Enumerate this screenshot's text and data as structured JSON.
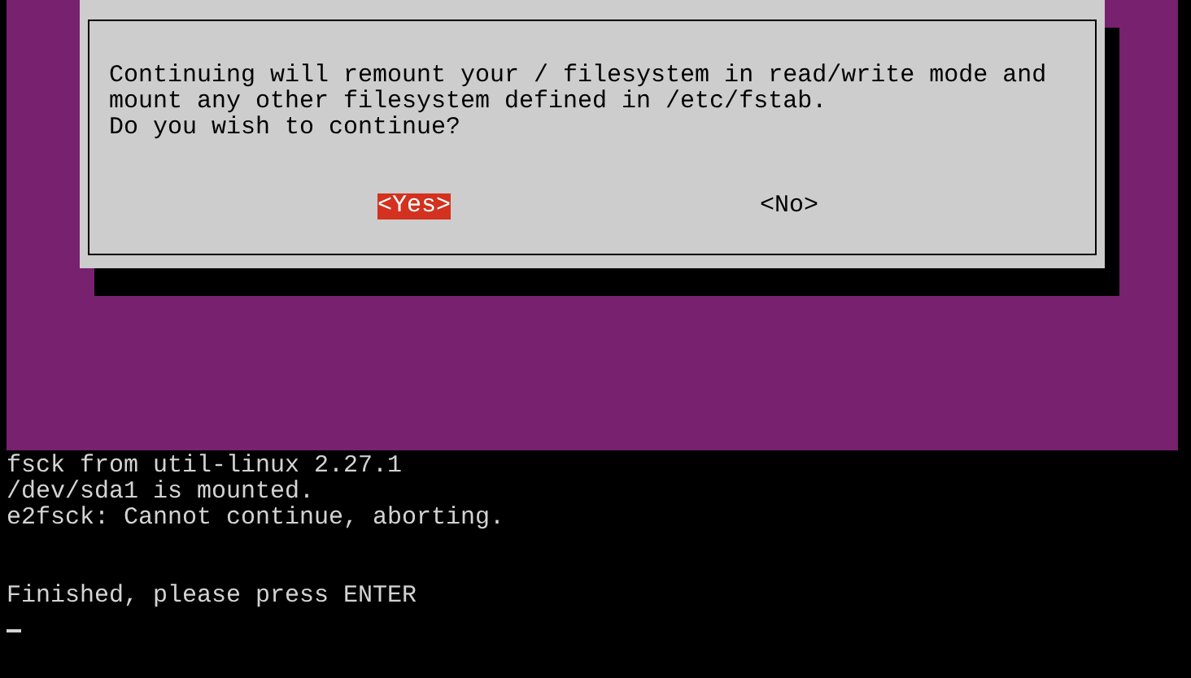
{
  "dialog": {
    "message": [
      "Continuing will remount your / filesystem in read/write mode and",
      "mount any other filesystem defined in /etc/fstab.",
      "Do you wish to continue?"
    ],
    "buttons": [
      {
        "label": "<Yes>",
        "selected": true
      },
      {
        "label": "<No>",
        "selected": false
      }
    ]
  },
  "console": {
    "lines": [
      "fsck from util-linux 2.27.1",
      "/dev/sda1 is mounted.",
      "e2fsck: Cannot continue, aborting."
    ],
    "prompt": "Finished, please press ENTER"
  }
}
